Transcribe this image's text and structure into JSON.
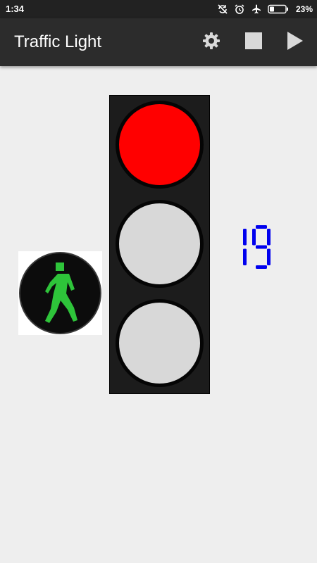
{
  "status_bar": {
    "time": "1:34",
    "battery_percent": "23%",
    "icons": [
      "sync-off-icon",
      "alarm-icon",
      "airplane-mode-icon",
      "battery-icon"
    ]
  },
  "app_bar": {
    "title": "Traffic Light",
    "actions": [
      "settings-icon",
      "stop-icon",
      "play-icon"
    ]
  },
  "pedestrian_signal": {
    "state": "walk",
    "figure_color": "#2ec43a"
  },
  "traffic_light": {
    "lamps": [
      {
        "name": "red",
        "lit": true,
        "color": "#ff0000"
      },
      {
        "name": "yellow",
        "lit": false,
        "color": "#d8d8d8"
      },
      {
        "name": "green",
        "lit": false,
        "color": "#d8d8d8"
      }
    ]
  },
  "countdown": {
    "value": "19",
    "color": "#0000ee"
  }
}
